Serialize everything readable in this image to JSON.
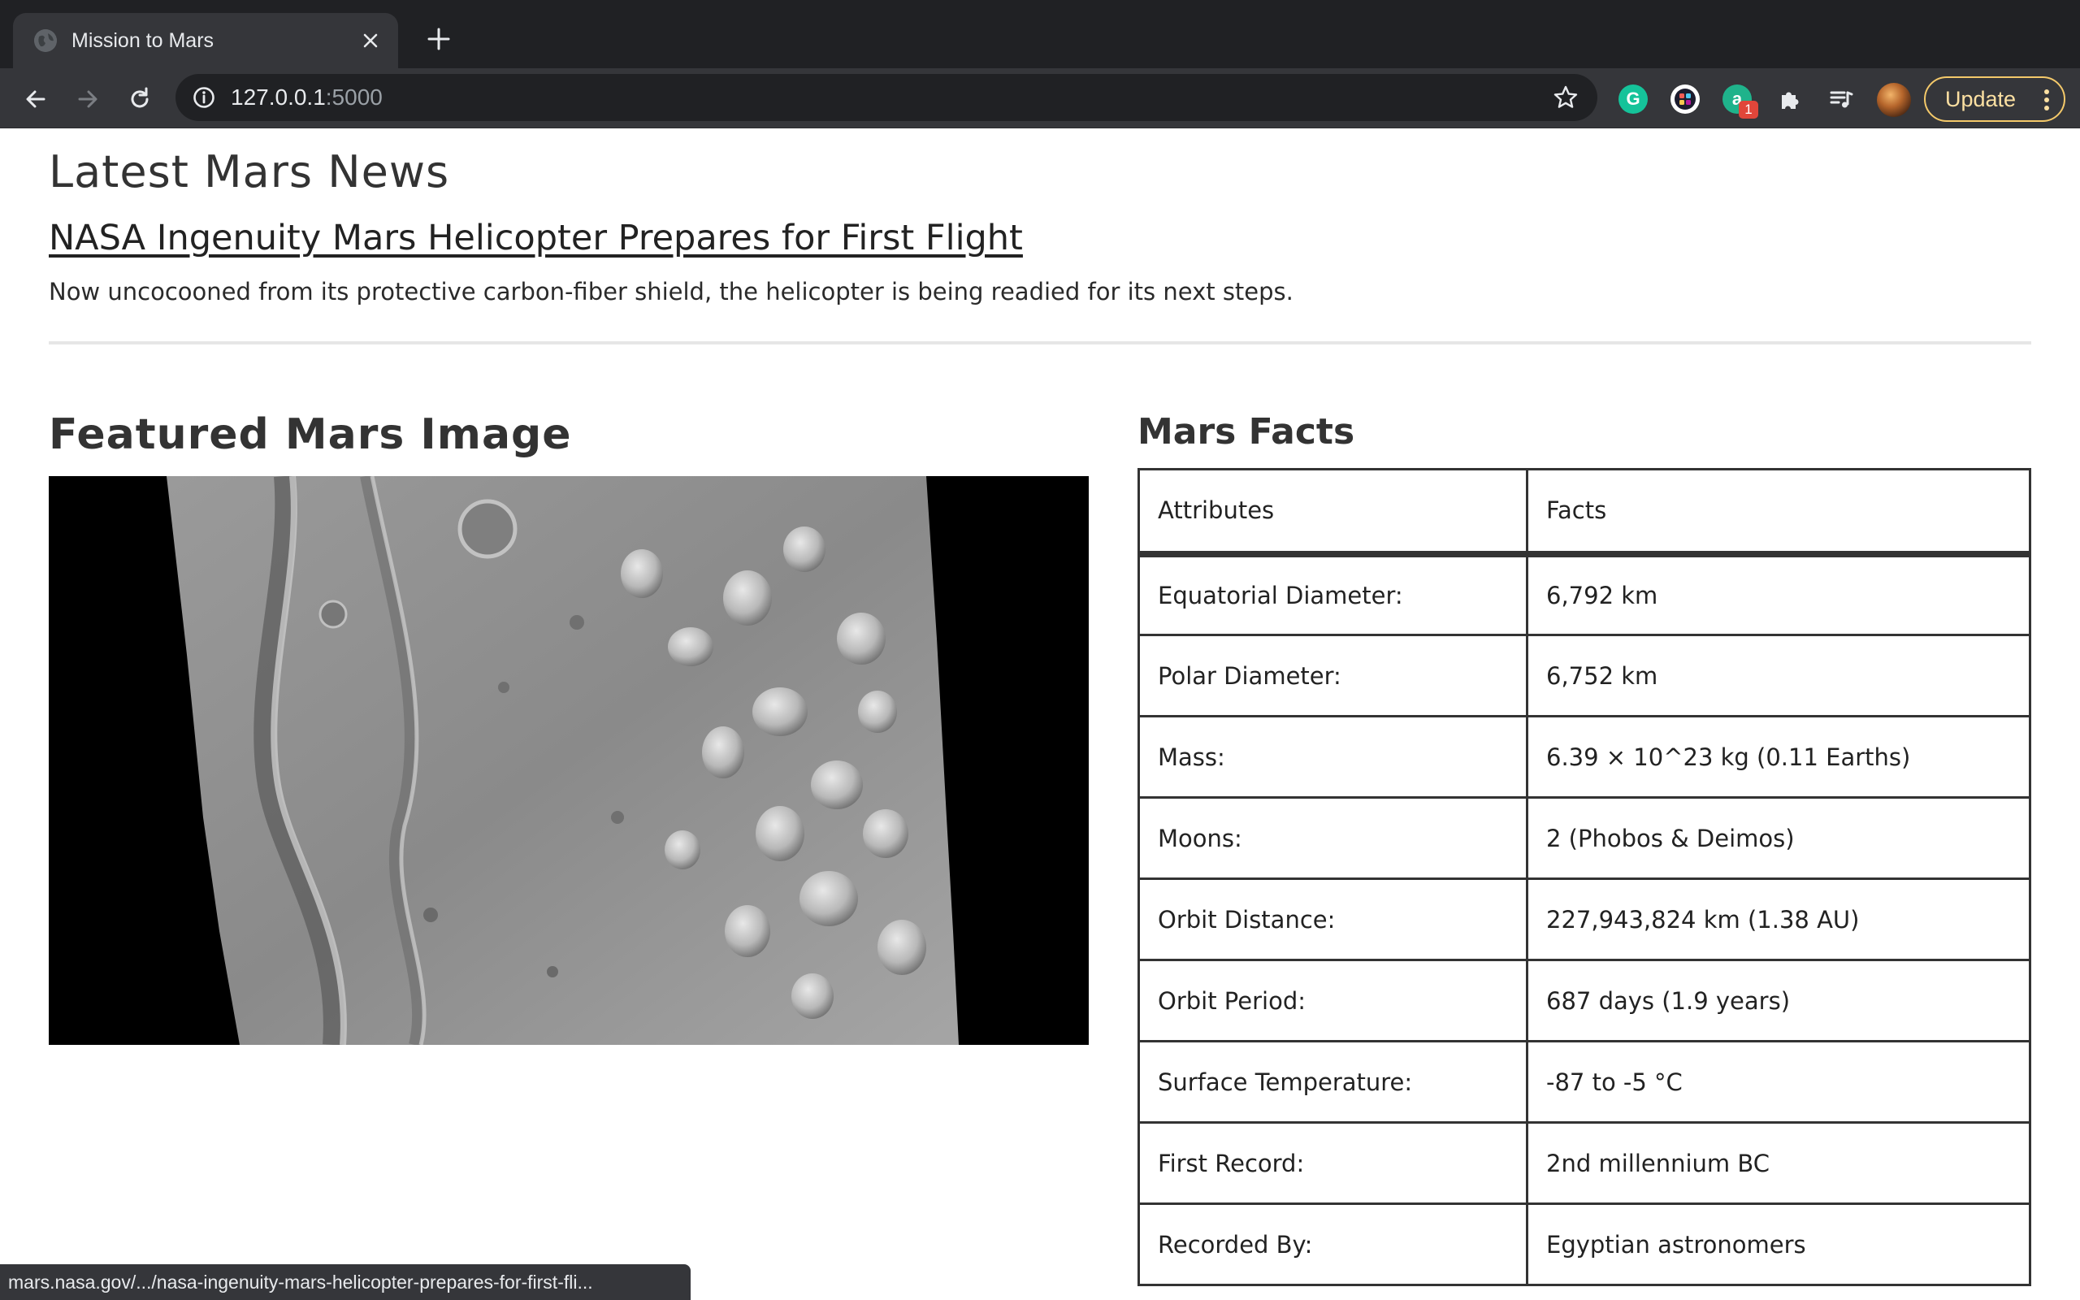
{
  "browser": {
    "tab": {
      "title": "Mission to Mars"
    },
    "address": {
      "host": "127.0.0.1",
      "port": ":5000"
    },
    "extensions": {
      "grammarly_letter": "G",
      "ahoy_letter": "a",
      "ahoy_badge": "1"
    },
    "update_label": "Update",
    "status_url": "mars.nasa.gov/.../nasa-ingenuity-mars-helicopter-prepares-for-first-fli..."
  },
  "news": {
    "heading": "Latest Mars News",
    "title": "NASA Ingenuity Mars Helicopter Prepares for First Flight",
    "teaser": "Now uncocooned from its protective carbon-fiber shield, the helicopter is being readied for its next steps."
  },
  "featured": {
    "heading": "Featured Mars Image"
  },
  "facts": {
    "heading": "Mars Facts",
    "columns": [
      "Attributes",
      "Facts"
    ],
    "rows": [
      [
        "Equatorial Diameter:",
        "6,792 km"
      ],
      [
        "Polar Diameter:",
        "6,752 km"
      ],
      [
        "Mass:",
        "6.39 × 10^23 kg (0.11 Earths)"
      ],
      [
        "Moons:",
        "2 (Phobos & Deimos)"
      ],
      [
        "Orbit Distance:",
        "227,943,824 km (1.38 AU)"
      ],
      [
        "Orbit Period:",
        "687 days (1.9 years)"
      ],
      [
        "Surface Temperature:",
        "-87 to -5 °C"
      ],
      [
        "First Record:",
        "2nd millennium BC"
      ],
      [
        "Recorded By:",
        "Egyptian astronomers"
      ]
    ]
  }
}
